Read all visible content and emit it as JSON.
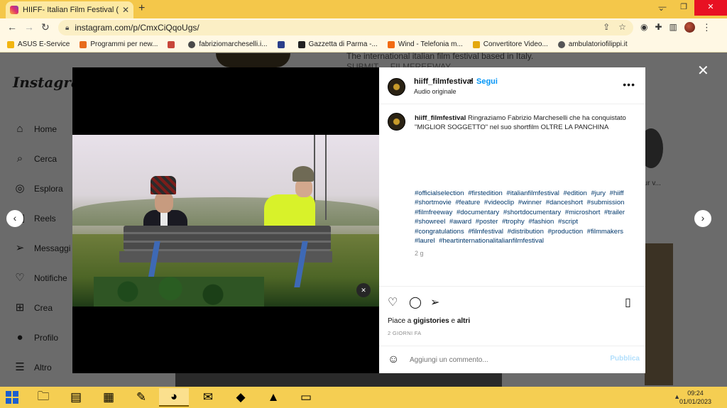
{
  "browser": {
    "tab_title": "HIIFF- Italian Film Festival (@hiiff",
    "tab_close": "✕",
    "new_tab": "+",
    "url": "instagram.com/p/CmxCiQqoUgs/",
    "bookmarks": [
      {
        "label": "ASUS E-Service",
        "color": "#f2b50f"
      },
      {
        "label": "Programmi per new...",
        "color": "#e86c1c"
      },
      {
        "label": "fabriziomarcheselli.i...",
        "color": "#4a4a4a"
      },
      {
        "label": "Gazzetta di Parma -...",
        "color": "#222222"
      },
      {
        "label": "Wind - Telefonia m...",
        "color": "#f26a10"
      },
      {
        "label": "Convertitore Video...",
        "color": "#e4a80e"
      },
      {
        "label": "ambulatoriofilippi.it",
        "color": "#555555"
      }
    ]
  },
  "instagram": {
    "logo": "Instagram",
    "nav": [
      {
        "label": "Home",
        "icon": "⌂"
      },
      {
        "label": "Cerca",
        "icon": "⌕"
      },
      {
        "label": "Esplora",
        "icon": "◎"
      },
      {
        "label": "Reels",
        "icon": "▣"
      },
      {
        "label": "Messaggi",
        "icon": "➢"
      },
      {
        "label": "Notifiche",
        "icon": "♡"
      },
      {
        "label": "Crea",
        "icon": "⊞"
      },
      {
        "label": "Profilo",
        "icon": "●"
      },
      {
        "label": "Altro",
        "icon": "☰"
      }
    ],
    "background": {
      "bio_line1": "The international italian film festival based in Italy.",
      "bio_line2": "SUBMIT ... FILMFREEWAY",
      "story_label": "Aur v..."
    }
  },
  "post": {
    "username": "hiiff_filmfestival",
    "separator": "•",
    "follow": "Segui",
    "audio": "Audio originale",
    "caption_text": "Ringraziamo Fabrizio Marcheselli che ha conquistato \"MIGLIOR SOGGETTO\" nel suo shortfilm OLTRE LA PANCHINA",
    "hashtags": [
      "#officialselection",
      "#firstedition",
      "#italianfilmfestival",
      "#edition",
      "#jury",
      "#hiiff",
      "#shortmovie",
      "#feature",
      "#videoclip",
      "#winner",
      "#danceshort",
      "#submission",
      "#filmfreeway",
      "#documentary",
      "#shortdocumentary",
      "#microshort",
      "#trailer",
      "#showreel",
      "#award",
      "#poster",
      "#trophy",
      "#fashion",
      "#script",
      "#congratulations",
      "#filmfestival",
      "#distribution",
      "#production",
      "#filmmakers",
      "#laurel",
      "#heartinternationalitalianfilmfestival"
    ],
    "caption_age": "2 g",
    "likes_prefix": "Piace a ",
    "likes_user": "gigistories",
    "likes_suffix": " e ",
    "likes_others": "altri",
    "posted": "2 GIORNI FA",
    "comment_placeholder": "Aggiungi un commento...",
    "publish": "Pubblica"
  },
  "taskbar": {
    "time": "09:24",
    "date": "01/01/2023",
    "apps": [
      "file-explorer-icon",
      "archive-icon",
      "calculator-icon",
      "paint-icon",
      "chrome-icon",
      "thunderbird-icon",
      "inkscape-icon",
      "vlc-icon",
      "notepad-icon"
    ]
  }
}
